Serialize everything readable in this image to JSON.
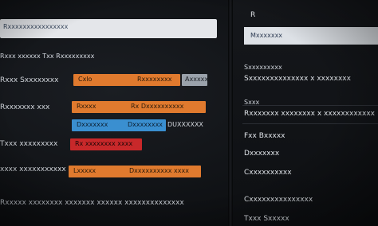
{
  "left": {
    "header": "Rxxxxxxxxxxxxxxxx",
    "section_title": "Rxxx xxxxxx Txx Rxxxxxxxxx",
    "rows": [
      {
        "label": "Rxxx Sxxxxxxxx",
        "bar_text": "Cxlo",
        "bar_text2": "Rxxxxxxxx",
        "chip": "Axxxxx"
      },
      {
        "label": "Rxxxxxxx xxx",
        "bar_text": "Rxxxx",
        "bar_text2": "Rx Dxxxxxxxxxx"
      },
      {
        "label": "Txxx xxxxxxxxx",
        "bar_text": "Dxxxxxxx",
        "bar_text2": "Dxxxxxxxx",
        "chip": "DUXXXXXX"
      },
      {
        "label": "Cxxx Ixxxxxx xx",
        "bar_text": "Rx xxxxxxxx xxxx"
      },
      {
        "label": "xxxx xxxxxxxxxxx",
        "bar_text": "Lxxxxx",
        "bar_text2": "Dxxxxxxxxxx xxxx"
      }
    ],
    "footer": "Rxxxxx xxxxxxxx xxxxxxx xxxxxx xxxxxxxxxxxxxx"
  },
  "right": {
    "top": "R",
    "field": "Mxxxxxxx",
    "items": [
      {
        "label": "Sxxxxxxxxx",
        "value": "Sxxxxxxxxxxxxxx x xxxxxxxx"
      },
      {
        "label": "Sxxx",
        "value": "Rxxxxxxx xxxxxxxx x xxxxxxxxxxxx"
      },
      {
        "label": "Fxxx",
        "value": "Fxx Bxxxxx"
      },
      {
        "label": "Dxxxxxxx",
        "value": "Dxxxxxxx"
      },
      {
        "label": "Cxxxxxxxxxx",
        "value": "Cxxxxxxxxxxxxxxx"
      },
      {
        "label": "Txxx Sxxxxx",
        "value": ""
      }
    ]
  },
  "colors": {
    "orange": "#e07a2e",
    "blue": "#3a8fd0",
    "red": "#c8282a",
    "grey": "#9aa2ab"
  }
}
